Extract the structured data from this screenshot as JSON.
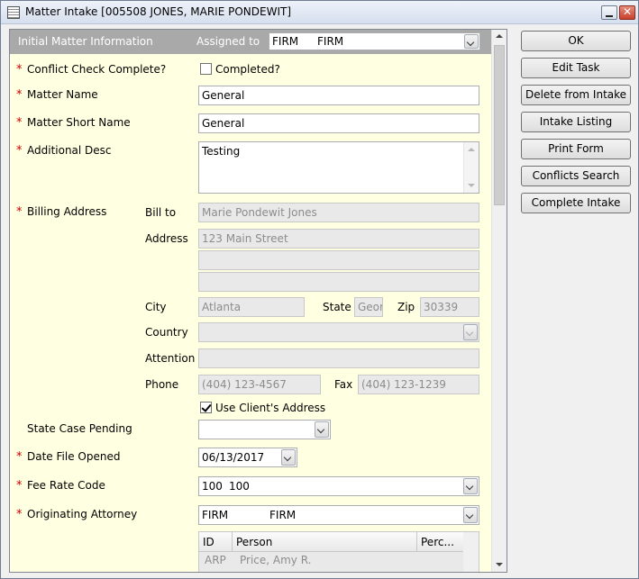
{
  "window": {
    "title": "Matter Intake [005508 JONES, MARIE PONDEWIT]"
  },
  "header": {
    "section_title": "Initial Matter Information",
    "assigned_label": "Assigned to",
    "assigned_code": "FIRM",
    "assigned_name": "FIRM"
  },
  "form": {
    "conflict_check_label": "Conflict Check Complete?",
    "completed_label": "Completed?",
    "completed_checked": false,
    "matter_name_label": "Matter Name",
    "matter_name_value": "General",
    "matter_short_name_label": "Matter Short Name",
    "matter_short_name_value": "General",
    "additional_desc_label": "Additional Desc",
    "additional_desc_value": "Testing",
    "billing_address_label": "Billing Address",
    "bill_to_label": "Bill to",
    "bill_to_value": "Marie Pondewit Jones",
    "address_label": "Address",
    "address_line1": "123 Main Street",
    "address_line2": "",
    "address_line3": "",
    "city_label": "City",
    "city_value": "Atlanta",
    "state_label": "State",
    "state_value": "Geor",
    "zip_label": "Zip",
    "zip_value": "30339",
    "country_label": "Country",
    "country_value": "",
    "attention_label": "Attention",
    "attention_value": "",
    "phone_label": "Phone",
    "phone_value": "(404) 123-4567",
    "fax_label": "Fax",
    "fax_value": "(404) 123-1239",
    "use_client_address_label": "Use Client's Address",
    "use_client_address_checked": true,
    "state_case_pending_label": "State Case Pending",
    "state_case_pending_value": "",
    "date_file_opened_label": "Date File Opened",
    "date_file_opened_value": "06/13/2017",
    "fee_rate_code_label": "Fee Rate Code",
    "fee_rate_code_value": "100",
    "fee_rate_code_desc": "100",
    "originating_attorney_label": "Originating Attorney",
    "originating_attorney_code": "FIRM",
    "originating_attorney_name": "FIRM",
    "required_marker": "*"
  },
  "attorney_grid": {
    "columns": [
      "ID",
      "Person",
      "Perc..."
    ],
    "rows": [
      {
        "id": "ARP",
        "person": "Price, Amy R.",
        "perc": ""
      }
    ]
  },
  "actions": {
    "ok": "OK",
    "edit_task": "Edit Task",
    "delete_from_intake": "Delete from Intake",
    "intake_listing": "Intake Listing",
    "print_form": "Print Form",
    "conflicts_search": "Conflicts Search",
    "complete_intake": "Complete Intake"
  },
  "colors": {
    "form_background": "#ffffe1",
    "header_background": "#a9a9a9",
    "required_marker": "#cc0000"
  }
}
